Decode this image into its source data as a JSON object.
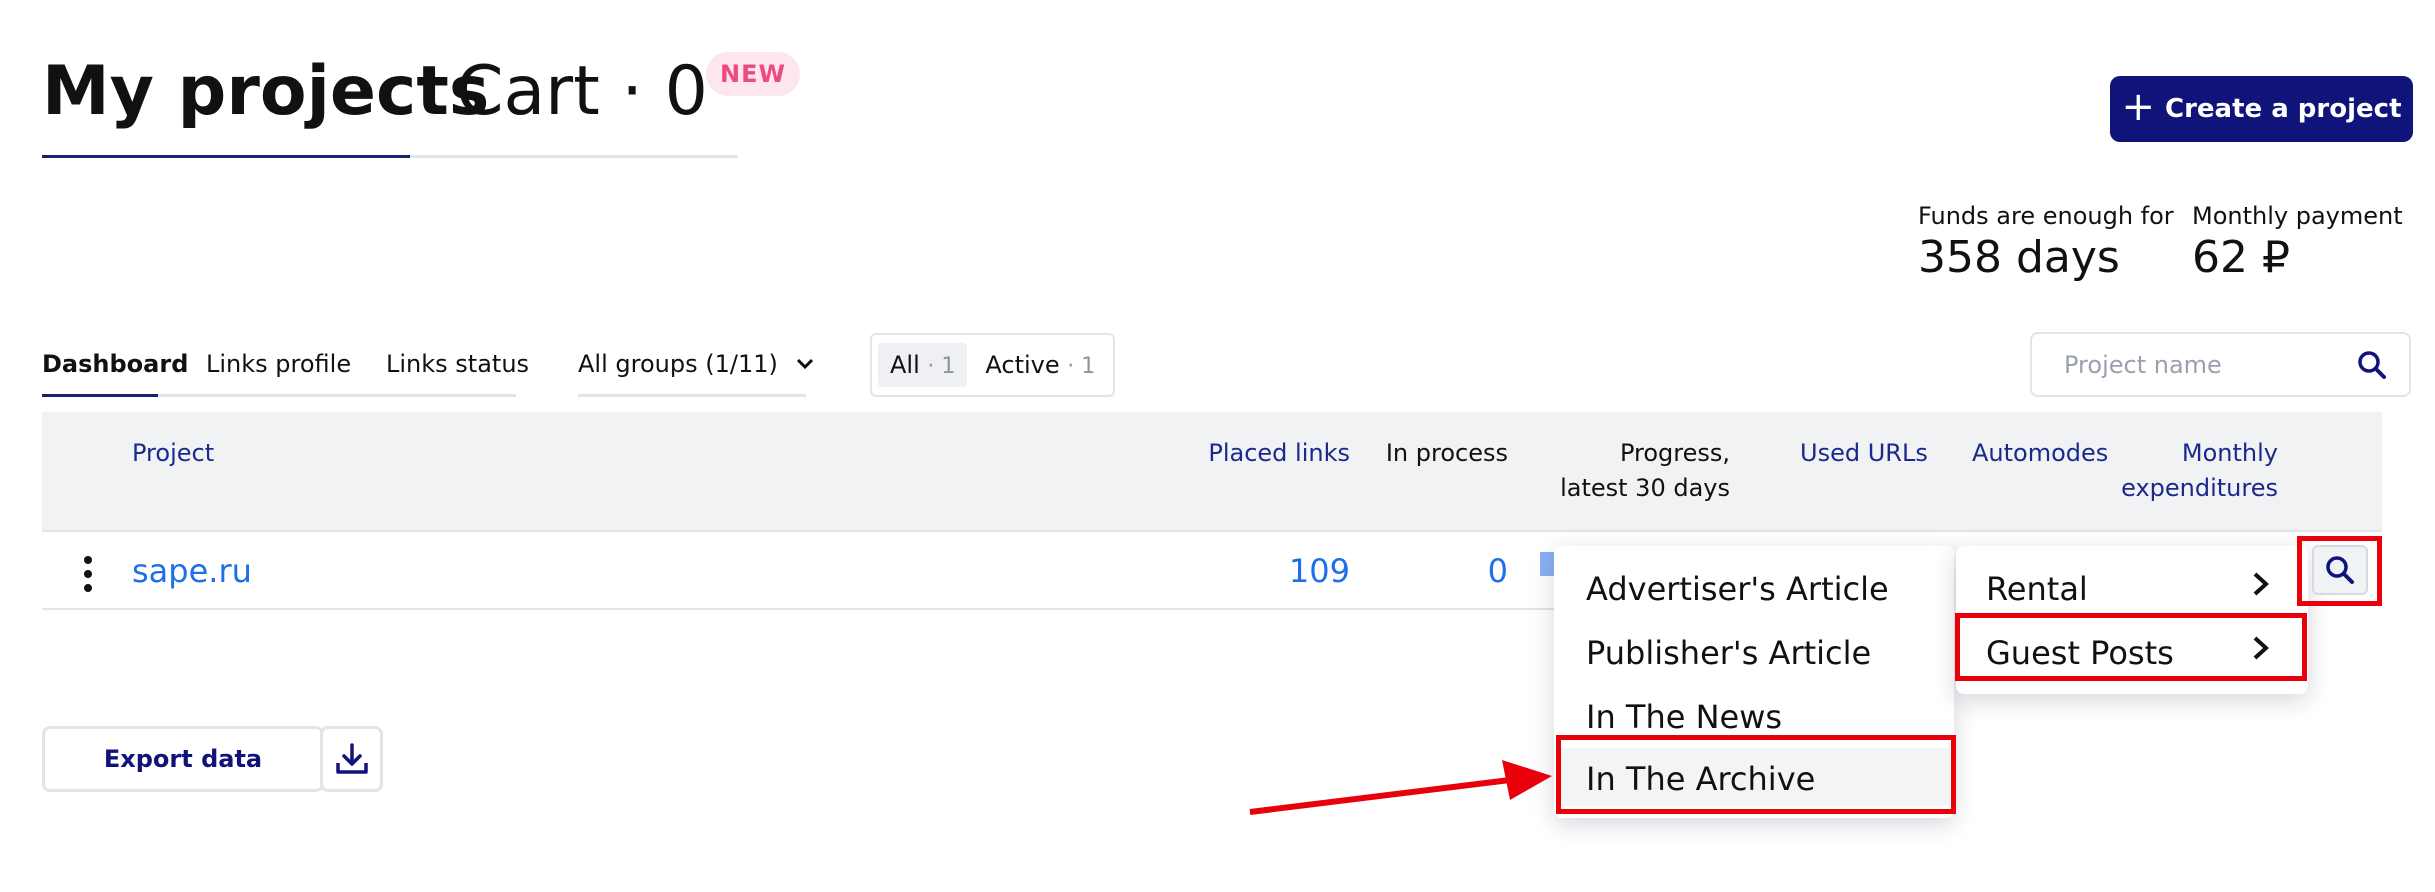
{
  "header": {
    "tab_projects": "My projects",
    "tab_cart": "Cart · 0",
    "new_badge": "NEW",
    "create_button": "Create a project"
  },
  "funds": {
    "enough_label": "Funds are enough for",
    "enough_value": "358 days",
    "monthly_label": "Monthly payment",
    "monthly_value": "62 ₽"
  },
  "subtabs": [
    "Dashboard",
    "Links profile",
    "Links status"
  ],
  "groups_select": "All groups (1/11)",
  "segment": [
    {
      "label": "All",
      "count": "· 1"
    },
    {
      "label": "Active",
      "count": "· 1"
    }
  ],
  "search": {
    "placeholder": "Project name"
  },
  "table": {
    "headers": {
      "project": "Project",
      "placed_links": "Placed links",
      "in_process": "In process",
      "progress_l1": "Progress,",
      "progress_l2": "latest 30 days",
      "used_urls": "Used URLs",
      "automodes": "Automodes",
      "monthly_l1": "Monthly",
      "monthly_l2": "expenditures"
    },
    "rows": [
      {
        "project": "sape.ru",
        "placed_links": "109",
        "in_process": "0"
      }
    ]
  },
  "submenu": {
    "items": [
      "Advertiser's Article",
      "Publisher's Article",
      "In The News",
      "In The Archive"
    ],
    "highlighted_index": 3
  },
  "menu": {
    "items": [
      "Rental",
      "Guest Posts"
    ],
    "highlighted_index": 1
  },
  "export_button": "Export data",
  "colors": {
    "accent": "#10137a",
    "link": "#1e6fe8",
    "annotation": "#e8000b"
  },
  "icons": [
    "plus-icon",
    "chevron-down-icon",
    "search-icon",
    "kebab-icon",
    "chevron-right-icon",
    "download-icon",
    "arrow-annotation"
  ]
}
